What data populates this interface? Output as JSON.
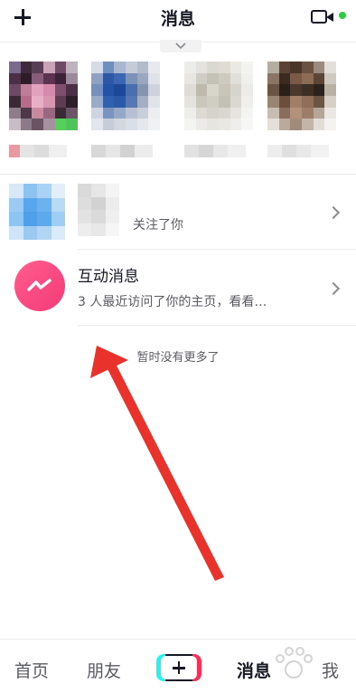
{
  "header": {
    "title": "消息",
    "left_icon": "plus-icon",
    "right_icon": "video-camera-icon",
    "online_dot_color": "#2ecc40"
  },
  "conversations": {
    "follower": {
      "subtitle": "关注了你"
    },
    "interaction": {
      "title": "互动消息",
      "subtitle": "3 人最近访问了你的主页，看看…",
      "icon": "interaction-bubble-icon",
      "accent": "#f43a77"
    }
  },
  "footer_note": "暂时没有更多了",
  "annotation": {
    "color": "#e8322b"
  },
  "tabbar": {
    "home": "首页",
    "friends": "朋友",
    "create_icon": "create-plus-icon",
    "messages": "消息",
    "me": "我"
  }
}
